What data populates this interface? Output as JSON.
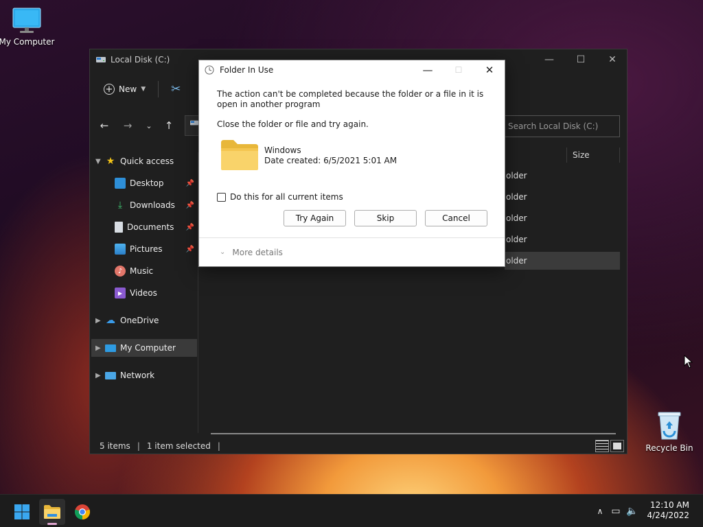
{
  "desktop": {
    "my_computer_label": "My Computer",
    "recycle_bin_label": "Recycle Bin"
  },
  "explorer": {
    "title": "Local Disk (C:)",
    "toolbar": {
      "new_label": "New"
    },
    "search_placeholder": "Search Local Disk (C:)",
    "column_size": "Size",
    "sidebar": {
      "quick_access": "Quick access",
      "desktop": "Desktop",
      "downloads": "Downloads",
      "documents": "Documents",
      "pictures": "Pictures",
      "music": "Music",
      "videos": "Videos",
      "onedrive": "OneDrive",
      "my_computer": "My Computer",
      "network": "Network"
    },
    "rows": [
      "older",
      "older",
      "older",
      "older",
      "older"
    ],
    "status": {
      "items": "5 items",
      "selected": "1 item selected"
    }
  },
  "dialog": {
    "title": "Folder In Use",
    "message": "The action can't be completed because the folder or a file in it is open in another program",
    "instruction": "Close the folder or file and try again.",
    "item_name": "Windows",
    "item_date": "Date created: 6/5/2021 5:01 AM",
    "checkbox_label": "Do this for all current items",
    "try_again": "Try Again",
    "skip": "Skip",
    "cancel": "Cancel",
    "more_details": "More details"
  },
  "taskbar": {
    "time": "12:10 AM",
    "date": "4/24/2022"
  }
}
